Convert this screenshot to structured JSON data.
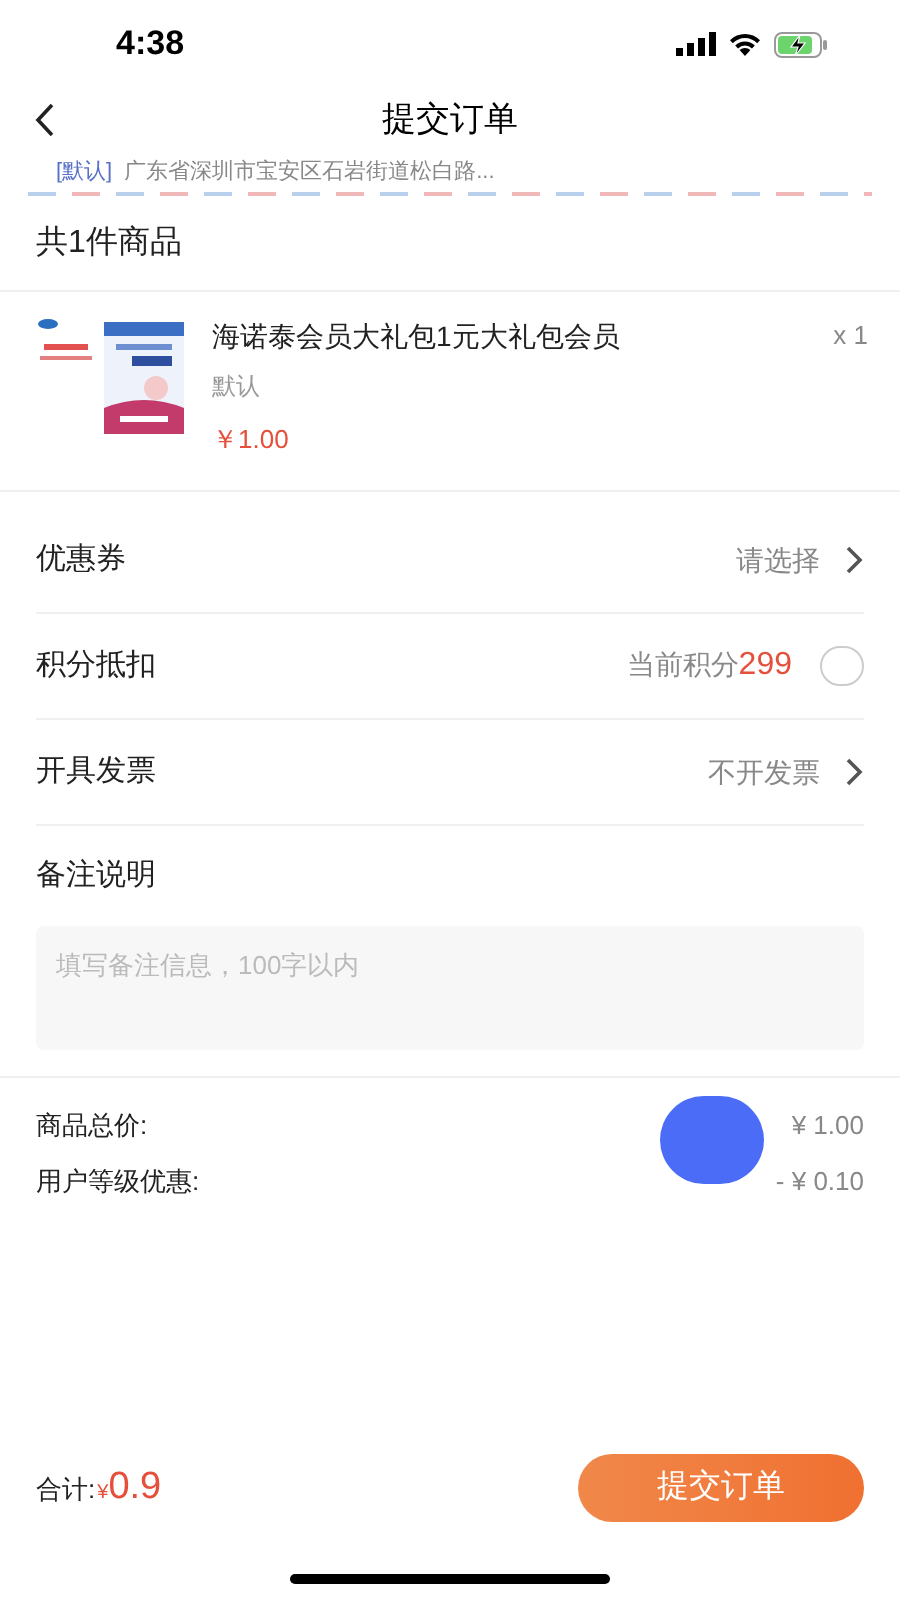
{
  "status_bar": {
    "time": "4:38"
  },
  "header": {
    "title": "提交订单"
  },
  "address": {
    "tag": "[默认]",
    "text": "广东省深圳市宝安区石岩街道松白路..."
  },
  "goods": {
    "count_label": "共1件商品",
    "items": [
      {
        "name": "海诺泰会员大礼包1元大礼包会员",
        "spec": "默认",
        "price": "￥1.00",
        "quantity": "x 1",
        "kind": "picture"
      }
    ]
  },
  "options": [
    {
      "kind": "link",
      "label": "优惠券",
      "value": "请选择"
    },
    {
      "kind": "toggle",
      "label": "积分抵扣",
      "value_prefix": "当前积分",
      "points": "299",
      "checked": false
    },
    {
      "kind": "link",
      "label": "开具发票",
      "value": "不开发票"
    }
  ],
  "remark": {
    "label": "备注说明",
    "placeholder": "填写备注信息，100字以内"
  },
  "summary": [
    {
      "label": "商品总价:",
      "value": "¥ 1.00"
    },
    {
      "label": "用户等级优惠:",
      "value": "- ¥ 0.10"
    }
  ],
  "footer": {
    "total_label": "合计:",
    "currency": "¥",
    "total": "0.9",
    "submit": "提交订单"
  }
}
